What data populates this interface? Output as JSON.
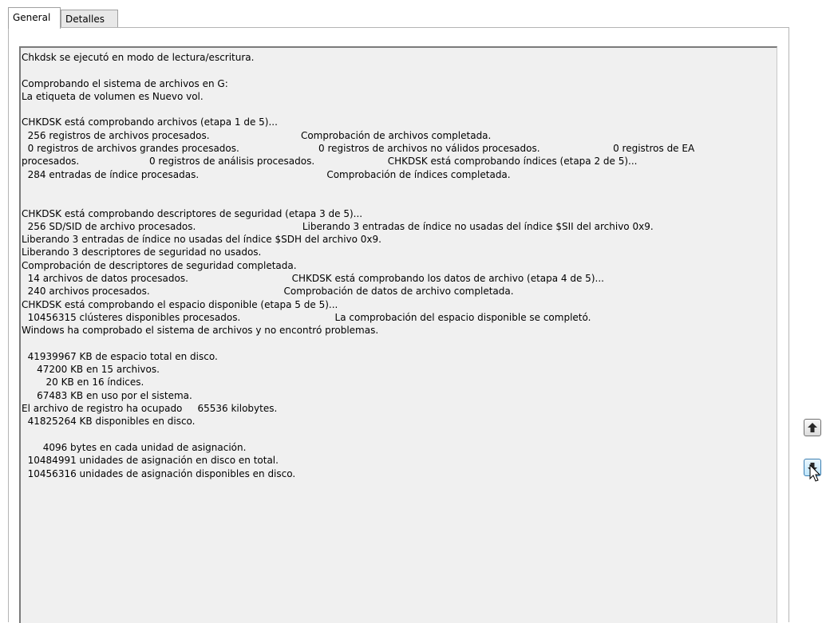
{
  "tabs": [
    {
      "label": "General",
      "active": true
    },
    {
      "label": "Detalles",
      "active": false
    }
  ],
  "log": {
    "text": "Chkdsk se ejecutó en modo de lectura/escritura.\n\nComprobando el sistema de archivos en G:\nLa etiqueta de volumen es Nuevo vol.\n\nCHKDSK está comprobando archivos (etapa 1 de 5)...\n  256 registros de archivos procesados.                              Comprobación de archivos completada.\n  0 registros de archivos grandes procesados.                          0 registros de archivos no válidos procesados.                        0 registros de EA procesados.                       0 registros de análisis procesados.                        CHKDSK está comprobando índices (etapa 2 de 5)...\n  284 entradas de índice procesadas.                                          Comprobación de índices completada.\n\n\nCHKDSK está comprobando descriptores de seguridad (etapa 3 de 5)...\n  256 SD/SID de archivo procesados.                                   Liberando 3 entradas de índice no usadas del índice $SII del archivo 0x9.\nLiberando 3 entradas de índice no usadas del índice $SDH del archivo 0x9.\nLiberando 3 descriptores de seguridad no usados.\nComprobación de descriptores de seguridad completada.\n  14 archivos de datos procesados.                                  CHKDSK está comprobando los datos de archivo (etapa 4 de 5)...\n  240 archivos procesados.                                            Comprobación de datos de archivo completada.\nCHKDSK está comprobando el espacio disponible (etapa 5 de 5)...\n  10456315 clústeres disponibles procesados.                               La comprobación del espacio disponible se completó.\nWindows ha comprobado el sistema de archivos y no encontró problemas.\n\n  41939967 KB de espacio total en disco.\n     47200 KB en 15 archivos.\n        20 KB en 16 índices.\n     67483 KB en uso por el sistema.\nEl archivo de registro ha ocupado     65536 kilobytes.\n  41825264 KB disponibles en disco.\n\n       4096 bytes en cada unidad de asignación.\n  10484991 unidades de asignación en disco en total.\n  10456316 unidades de asignación disponibles en disco."
  },
  "buttons": {
    "up": {
      "icon": "arrow-up-icon"
    },
    "down": {
      "icon": "arrow-down-icon"
    }
  }
}
